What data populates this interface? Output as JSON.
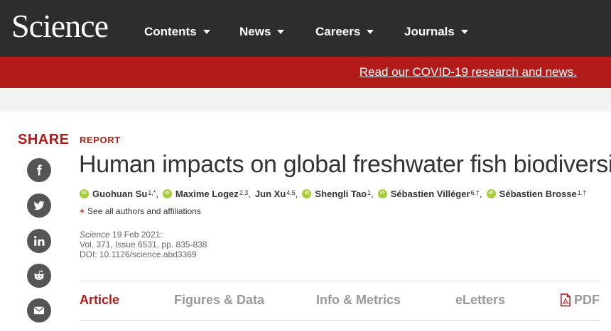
{
  "header": {
    "logo": "Science",
    "nav": [
      {
        "label": "Contents"
      },
      {
        "label": "News"
      },
      {
        "label": "Careers"
      },
      {
        "label": "Journals"
      }
    ]
  },
  "banner": {
    "link_text": "Read our COVID-19 research and news."
  },
  "share": {
    "label": "SHARE",
    "buttons": [
      "facebook-icon",
      "twitter-icon",
      "linkedin-icon",
      "reddit-icon",
      "email-icon"
    ]
  },
  "article": {
    "type": "REPORT",
    "title": "Human impacts on global freshwater fish biodiversity",
    "authors": [
      {
        "name": "Guohuan Su",
        "sup": "1,*",
        "orcid": true
      },
      {
        "name": "Maxime Logez",
        "sup": "2,3",
        "orcid": true
      },
      {
        "name": "Jun Xu",
        "sup": "4,5",
        "orcid": false
      },
      {
        "name": "Shengli Tao",
        "sup": "1",
        "orcid": true
      },
      {
        "name": "Sébastien Villéger",
        "sup": "6,†",
        "orcid": true
      },
      {
        "name": "Sébastien Brosse",
        "sup": "1,†",
        "orcid": true
      }
    ],
    "orcid_label": "iD",
    "see_all": "See all authors and affiliations",
    "citation": {
      "journal": "Science",
      "date": "19 Feb 2021:",
      "volume": "Vol. 371, Issue 6531, pp. 835-838",
      "doi": "DOI: 10.1126/science.abd3369"
    }
  },
  "tabs": [
    {
      "label": "Article",
      "active": true
    },
    {
      "label": "Figures & Data",
      "active": false
    },
    {
      "label": "Info & Metrics",
      "active": false
    },
    {
      "label": "eLetters",
      "active": false
    },
    {
      "label": "PDF",
      "active": false
    }
  ],
  "colors": {
    "brand_red": "#b31b1b",
    "nav_bg": "#2d2d2d",
    "orcid_green": "#a6ce39",
    "share_icon_bg": "#555555"
  }
}
